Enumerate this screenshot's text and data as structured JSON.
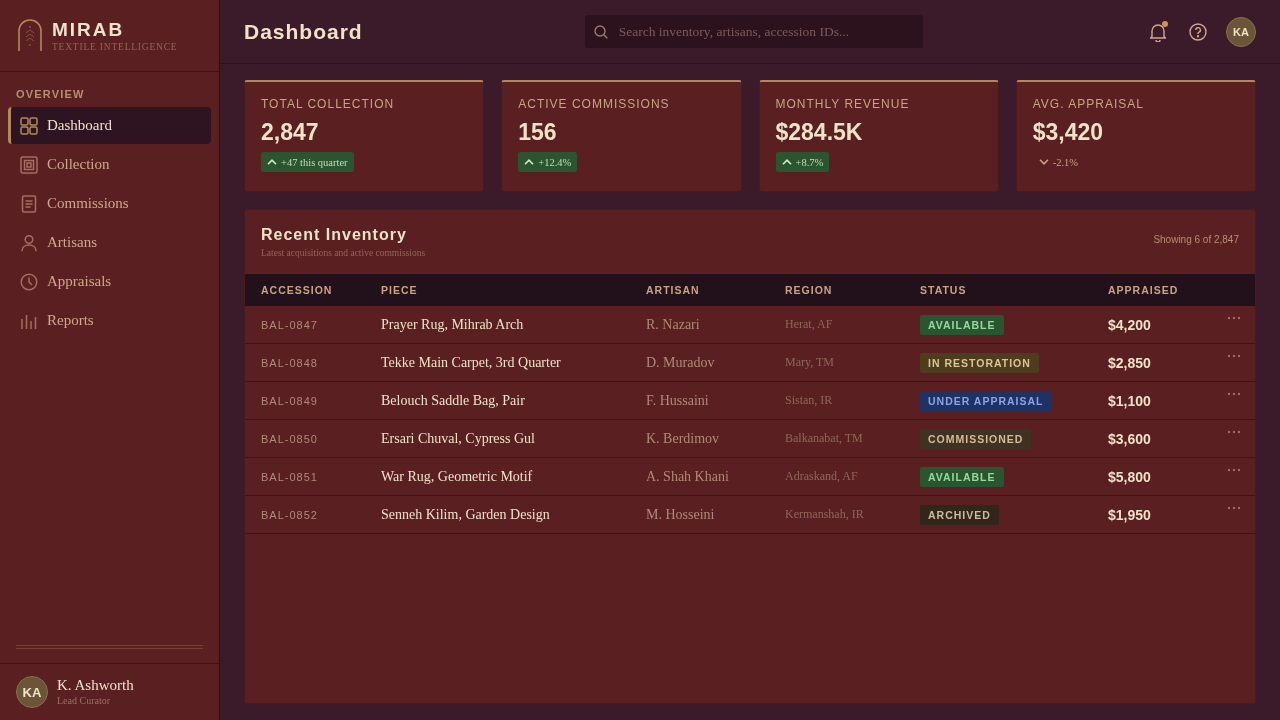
{
  "brand": {
    "name": "MIRAB",
    "tagline": "TEXTILE INTELLIGENCE"
  },
  "sidebar": {
    "section": "OVERVIEW",
    "items": [
      {
        "label": "Dashboard",
        "selected": true
      },
      {
        "label": "Collection",
        "selected": false
      },
      {
        "label": "Commissions",
        "selected": false
      },
      {
        "label": "Artisans",
        "selected": false
      },
      {
        "label": "Appraisals",
        "selected": false
      },
      {
        "label": "Reports",
        "selected": false
      }
    ],
    "user": {
      "initials": "KA",
      "name": "K. Ashworth",
      "role": "Lead Curator"
    }
  },
  "header": {
    "title": "Dashboard",
    "search": {
      "placeholder": "Search inventory, artisans, accession IDs..."
    },
    "notifications": {
      "unread": true
    },
    "avatar": "KA"
  },
  "stats": [
    {
      "label": "TOTAL COLLECTION",
      "value": "2,847",
      "delta": "+47 this quarter",
      "positive": true
    },
    {
      "label": "ACTIVE COMMISSIONS",
      "value": "156",
      "delta": "+12.4%",
      "positive": true
    },
    {
      "label": "MONTHLY REVENUE",
      "value": "$284.5K",
      "delta": "+8.7%",
      "positive": true
    },
    {
      "label": "AVG. APPRAISAL",
      "value": "$3,420",
      "delta": "-2.1%",
      "positive": false
    }
  ],
  "table": {
    "title": "Recent Inventory",
    "subtitle": "Latest acquisitions and active commissions",
    "count": "Showing 6 of 2,847",
    "columns": [
      "ACCESSION",
      "PIECE",
      "ARTISAN",
      "REGION",
      "STATUS",
      "APPRAISED"
    ],
    "rows": [
      {
        "accession": "BAL-0847",
        "piece": "Prayer Rug, Mihrab Arch",
        "artisan": "R. Nazari",
        "region": "Herat, AF",
        "status": {
          "label": "AVAILABLE",
          "color": "#2b5430"
        },
        "appraised": "$4,200"
      },
      {
        "accession": "BAL-0848",
        "piece": "Tekke Main Carpet, 3rd Quarter",
        "artisan": "D. Muradov",
        "region": "Mary, TM",
        "status": {
          "label": "IN RESTORATION",
          "color": "#4d3d1c"
        },
        "appraised": "$2,850"
      },
      {
        "accession": "BAL-0849",
        "piece": "Belouch Saddle Bag, Pair",
        "artisan": "F. Hussaini",
        "region": "Sistan, IR",
        "status": {
          "label": "UNDER APPRAISAL",
          "color": "#1f3264"
        },
        "appraised": "$1,100"
      },
      {
        "accession": "BAL-0850",
        "piece": "Ersari Chuval, Cypress Gul",
        "artisan": "K. Berdimov",
        "region": "Balkanabat, TM",
        "status": {
          "label": "COMMISSIONED",
          "color": "#3f3222"
        },
        "appraised": "$3,600"
      },
      {
        "accession": "BAL-0851",
        "piece": "War Rug, Geometric Motif",
        "artisan": "A. Shah Khani",
        "region": "Adraskand, AF",
        "status": {
          "label": "AVAILABLE",
          "color": "#2b5430"
        },
        "appraised": "$5,800"
      },
      {
        "accession": "BAL-0852",
        "piece": "Senneh Kilim, Garden Design",
        "artisan": "M. Hosseini",
        "region": "Kermanshah, IR",
        "status": {
          "label": "ARCHIVED",
          "color": "#30261c"
        },
        "appraised": "$1,950"
      }
    ]
  }
}
